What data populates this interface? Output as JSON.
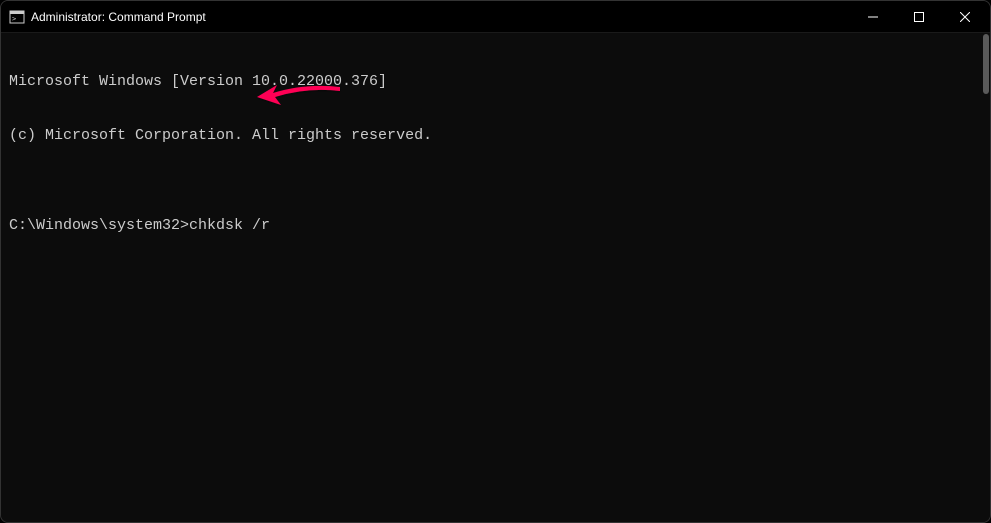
{
  "window": {
    "title": "Administrator: Command Prompt"
  },
  "terminal": {
    "line1": "Microsoft Windows [Version 10.0.22000.376]",
    "line2": "(c) Microsoft Corporation. All rights reserved.",
    "blank": "",
    "prompt": "C:\\Windows\\system32>",
    "command": "chkdsk /r"
  }
}
